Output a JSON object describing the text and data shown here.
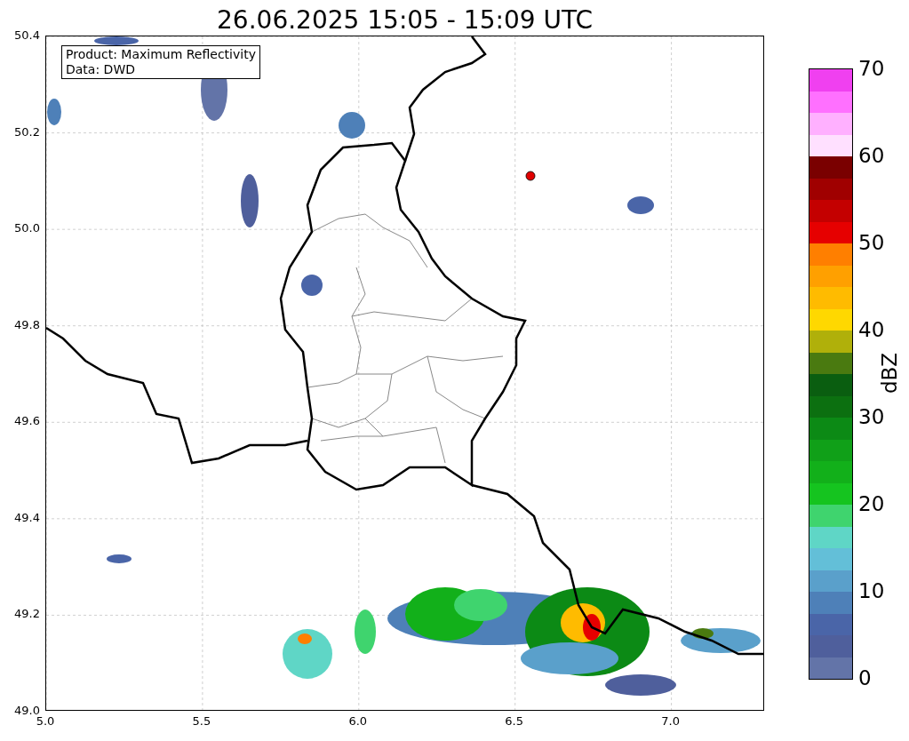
{
  "title": "26.06.2025 15:05 - 15:09 UTC",
  "legend": {
    "lines": [
      "Product: Maximum Reflectivity",
      "Data: DWD"
    ]
  },
  "axes": {
    "xticks": [
      "5.0",
      "5.5",
      "6.0",
      "6.5",
      "7.0"
    ],
    "yticks": [
      "50.4",
      "50.2",
      "50.0",
      "49.8",
      "49.6",
      "49.4",
      "49.2",
      "49.0"
    ]
  },
  "colorbar": {
    "label": "dBZ",
    "ticks": [
      "70",
      "60",
      "50",
      "40",
      "30",
      "20",
      "10",
      "0"
    ],
    "bins": [
      {
        "color": "#f040f0"
      },
      {
        "color": "#ff70ff"
      },
      {
        "color": "#ffb0ff"
      },
      {
        "color": "#ffe0ff"
      },
      {
        "color": "#7a0000"
      },
      {
        "color": "#a00000"
      },
      {
        "color": "#c40000"
      },
      {
        "color": "#e60000"
      },
      {
        "color": "#ff7f00"
      },
      {
        "color": "#ffa000"
      },
      {
        "color": "#ffbb00"
      },
      {
        "color": "#ffd800"
      },
      {
        "color": "#b0b00a"
      },
      {
        "color": "#4a7a10"
      },
      {
        "color": "#0a5e10"
      },
      {
        "color": "#0c7010"
      },
      {
        "color": "#0c8a15"
      },
      {
        "color": "#10a018"
      },
      {
        "color": "#12b01a"
      },
      {
        "color": "#15c41f"
      },
      {
        "color": "#3fd46e"
      },
      {
        "color": "#5fd6c6"
      },
      {
        "color": "#63bfd8"
      },
      {
        "color": "#5aa0cb"
      },
      {
        "color": "#4e80b8"
      },
      {
        "color": "#4a65a8"
      },
      {
        "color": "#4f5f9c"
      },
      {
        "color": "#6374a8"
      }
    ]
  }
}
